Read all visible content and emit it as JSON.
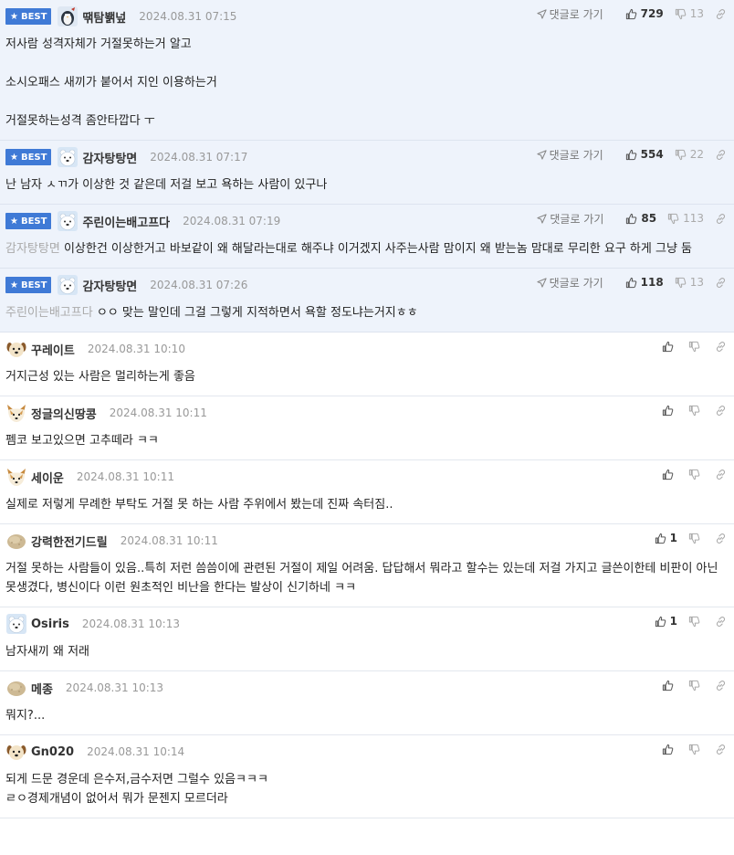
{
  "best_label": "BEST",
  "reply_label": "댓글로 가기",
  "colors": {
    "accent": "#3f7ad6",
    "best_bg": "#eef3fb"
  },
  "comments": [
    {
      "best": true,
      "nick": "땎탐봵넢",
      "avatar": "penguin-avatar",
      "date": "2024.08.31 07:15",
      "up": "729",
      "down": "13",
      "lines": [
        "저사람 성격자체가 거절못하는거 알고",
        "",
        "소시오패스 새끼가 붙어서 지인 이용하는거",
        "",
        "거절못하는성격 좀안타깝다 ㅜ"
      ]
    },
    {
      "best": true,
      "nick": "감자탕탕면",
      "avatar": "polar-bear-avatar",
      "date": "2024.08.31 07:17",
      "up": "554",
      "down": "22",
      "lines": [
        "난 남자 ㅅㄲ가 이상한 것 같은데 저걸 보고 욕하는 사람이 있구나"
      ]
    },
    {
      "best": true,
      "nick": "주린이는배고프다",
      "avatar": "polar-bear-avatar",
      "date": "2024.08.31 07:19",
      "up": "85",
      "down": "113",
      "mention": "감자탕탕면",
      "lines": [
        "이상한건 이상한거고 바보같이 왜 해달라는대로 해주냐 이거겠지 사주는사람 맘이지 왜 받는놈 맘대로 무리한 요구 하게 그냥 둠"
      ]
    },
    {
      "best": true,
      "nick": "감자탕탕면",
      "avatar": "polar-bear-avatar",
      "date": "2024.08.31 07:26",
      "up": "118",
      "down": "13",
      "mention": "주린이는배고프다",
      "lines": [
        "ㅇㅇ 맞는 말인데 그걸 그렇게 지적하면서 욕할 정도냐는거지ㅎㅎ"
      ]
    },
    {
      "best": false,
      "nick": "꾸레이트",
      "avatar": "dog-avatar",
      "date": "2024.08.31 10:10",
      "up": "",
      "down": "",
      "lines": [
        "거지근성 있는 사람은 멀리하는게 좋음"
      ]
    },
    {
      "best": false,
      "nick": "정글의신땅콩",
      "avatar": "fox-avatar",
      "date": "2024.08.31 10:11",
      "up": "",
      "down": "",
      "lines": [
        "펨코 보고있으면 고추떼라 ㅋㅋ"
      ]
    },
    {
      "best": false,
      "nick": "세이운",
      "avatar": "fox-avatar",
      "date": "2024.08.31 10:11",
      "up": "",
      "down": "",
      "lines": [
        "실제로 저렇게 무례한 부탁도 거절 못 하는 사람 주위에서 봤는데 진짜 속터짐.."
      ]
    },
    {
      "best": false,
      "nick": "강력한전기드릴",
      "avatar": "potato-avatar",
      "date": "2024.08.31 10:11",
      "up": "1",
      "down": "",
      "lines": [
        "거절 못하는 사람들이 있음..특히 저런 씀씀이에 관련된 거절이 제일 어려움. 답답해서 뭐라고 할수는 있는데 저걸 가지고 글쓴이한테 비판이 아닌 못생겼다, 병신이다 이런 원초적인 비난을 한다는 발상이 신기하네 ㅋㅋ"
      ]
    },
    {
      "best": false,
      "nick": "Osiris",
      "avatar": "polar-bear-avatar",
      "date": "2024.08.31 10:13",
      "up": "1",
      "down": "",
      "lines": [
        "남자새끼 왜 저래"
      ]
    },
    {
      "best": false,
      "nick": "메종",
      "avatar": "potato-avatar",
      "date": "2024.08.31 10:13",
      "up": "",
      "down": "",
      "lines": [
        "뭐지?..."
      ]
    },
    {
      "best": false,
      "nick": "Gn020",
      "avatar": "dog-avatar",
      "date": "2024.08.31 10:14",
      "up": "",
      "down": "",
      "lines": [
        "되게 드문 경운데 은수저,금수저면 그럴수 있음ㅋㅋㅋ",
        "ㄹㅇ경제개념이 없어서 뭐가 문젠지 모르더라"
      ]
    }
  ]
}
